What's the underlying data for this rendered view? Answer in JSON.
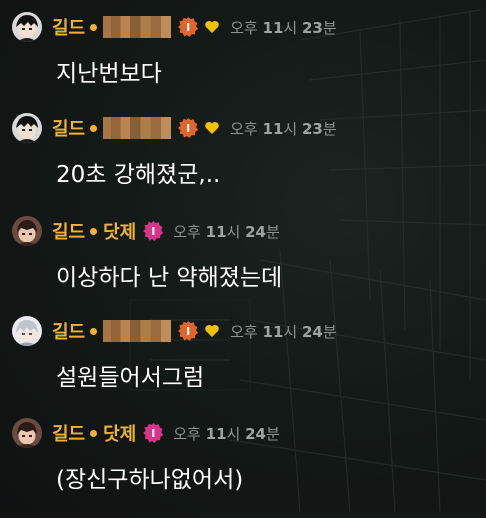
{
  "colors": {
    "guild": "#f2b233",
    "time": "#8b9290",
    "message": "#ffffff",
    "badge_orange": "#e0662b",
    "badge_pink": "#d8358a",
    "heart": "#f2c200"
  },
  "messages": [
    {
      "guild": "길드",
      "name": "",
      "name_pixelated": true,
      "badge": "I",
      "badge_icon": "orange-badge-icon",
      "heart": true,
      "time_prefix": "오후",
      "time_hour": "11",
      "time_hour_unit": "시",
      "time_min": "23",
      "time_min_unit": "분",
      "text": "지난번보다"
    },
    {
      "guild": "길드",
      "name": "",
      "name_pixelated": true,
      "badge": "I",
      "badge_icon": "orange-badge-icon",
      "heart": true,
      "time_prefix": "오후",
      "time_hour": "11",
      "time_hour_unit": "시",
      "time_min": "23",
      "time_min_unit": "분",
      "text": "20초 강해졌군,.."
    },
    {
      "guild": "길드",
      "name": "닷제",
      "name_pixelated": false,
      "badge": "I",
      "badge_icon": "pink-badge-icon",
      "heart": false,
      "time_prefix": "오후",
      "time_hour": "11",
      "time_hour_unit": "시",
      "time_min": "24",
      "time_min_unit": "분",
      "text": "이상하다 난 약해졌는데"
    },
    {
      "guild": "길드",
      "name": "",
      "name_pixelated": true,
      "badge": "I",
      "badge_icon": "orange-badge-icon",
      "heart": true,
      "time_prefix": "오후",
      "time_hour": "11",
      "time_hour_unit": "시",
      "time_min": "24",
      "time_min_unit": "분",
      "text": "설원들어서그럼"
    },
    {
      "guild": "길드",
      "name": "닷제",
      "name_pixelated": false,
      "badge": "I",
      "badge_icon": "pink-badge-icon",
      "heart": false,
      "time_prefix": "오후",
      "time_hour": "11",
      "time_hour_unit": "시",
      "time_min": "24",
      "time_min_unit": "분",
      "text": "(장신구하나없어서)"
    }
  ]
}
